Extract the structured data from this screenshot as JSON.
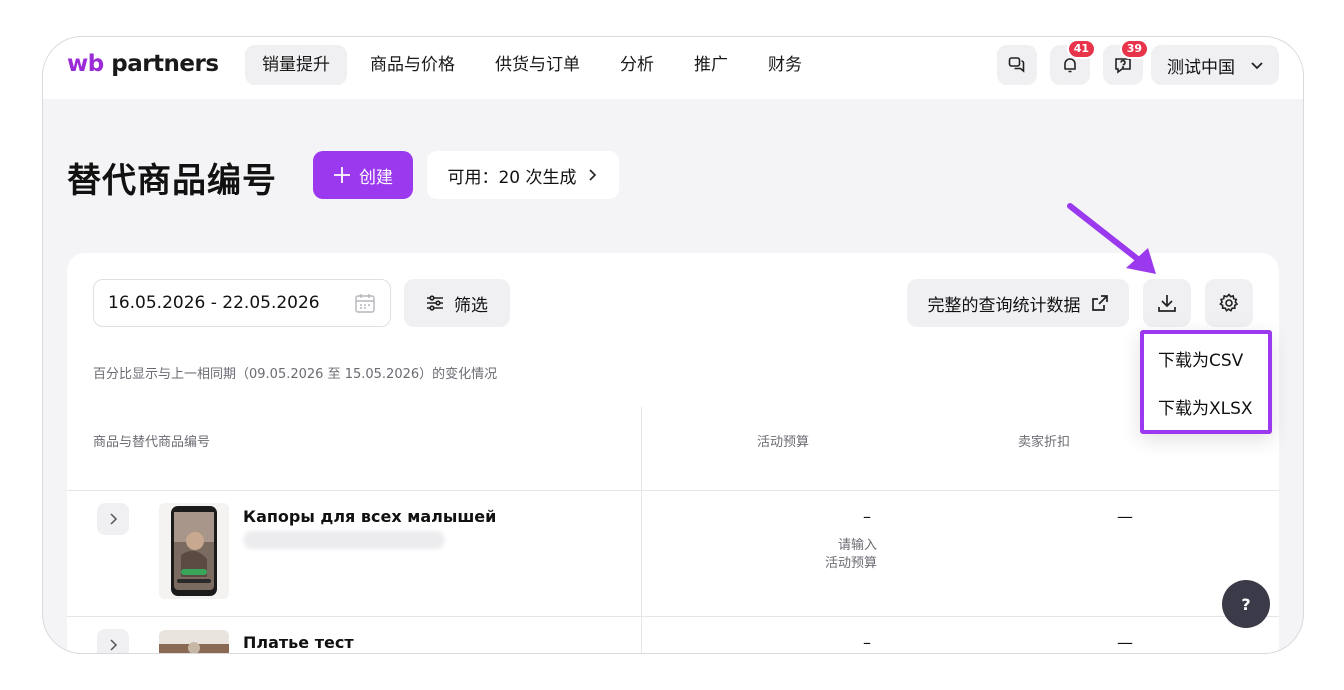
{
  "app": {
    "logo_prefix": "wb",
    "logo_suffix": " partners"
  },
  "nav": {
    "items": [
      {
        "label": "销量提升",
        "active": true
      },
      {
        "label": "商品与价格",
        "active": false
      },
      {
        "label": "供货与订单",
        "active": false
      },
      {
        "label": "分析",
        "active": false
      },
      {
        "label": "推广",
        "active": false
      },
      {
        "label": "财务",
        "active": false
      }
    ],
    "notifications_count": "41",
    "messages_count": "39",
    "region_label": "测试中国"
  },
  "page": {
    "title": "替代商品编号",
    "create_label": "创建",
    "available_label": "可用：20 次生成"
  },
  "toolbar": {
    "date_range": "16.05.2026 - 22.05.2026",
    "filter_label": "筛选",
    "stats_label": "完整的查询统计数据"
  },
  "compare_note": "百分比显示与上一相同期（09.05.2026 至 15.05.2026）的变化情况",
  "table": {
    "headers": [
      "商品与替代商品编号",
      "活动预算",
      "卖家折扣"
    ],
    "rows": [
      {
        "name": "Капоры для всех малышей",
        "budget": "–",
        "discount": "—",
        "hint_line1": "请输入",
        "hint_line2": "活动预算"
      },
      {
        "name": "Платье тест",
        "budget": "–",
        "discount": "—"
      }
    ]
  },
  "download_menu": {
    "items": [
      "下载为CSV",
      "下载为XLSX"
    ]
  },
  "help_label": "?",
  "colors": {
    "accent": "#9b39ee",
    "badge": "#e8344b",
    "background": "#f4f4f7"
  }
}
